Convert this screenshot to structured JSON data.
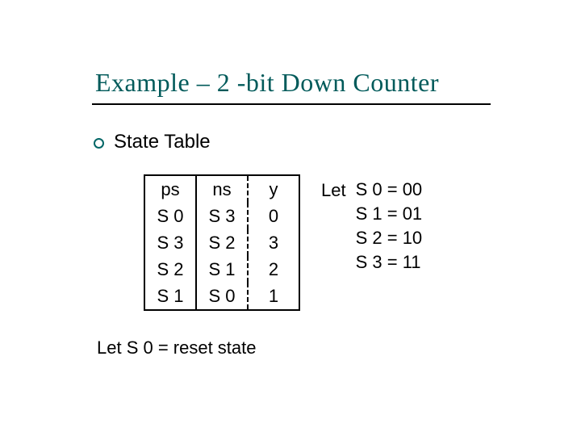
{
  "title": "Example – 2 -bit Down Counter",
  "bullet": "State Table",
  "table": {
    "headers": {
      "ps": "ps",
      "ns": "ns",
      "y": "y"
    },
    "rows": [
      {
        "ps": "S 0",
        "ns": "S 3",
        "y": "0"
      },
      {
        "ps": "S 3",
        "ns": "S 2",
        "y": "3"
      },
      {
        "ps": "S 2",
        "ns": "S 1",
        "y": "2"
      },
      {
        "ps": "S 1",
        "ns": "S 0",
        "y": "1"
      }
    ]
  },
  "let": {
    "word": "Let",
    "assignments": [
      "S 0 = 00",
      "S 1 = 01",
      "S 2 = 10",
      "S 3 = 11"
    ]
  },
  "reset_note": "Let S 0 = reset state"
}
